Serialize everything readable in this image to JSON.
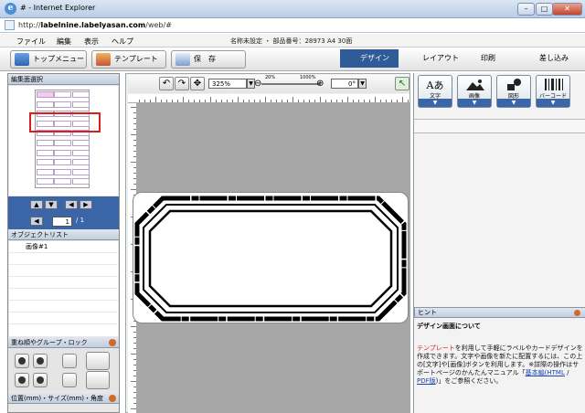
{
  "window": {
    "title": "# - Internet Explorer",
    "minimize": "–",
    "maximize": "□",
    "close": "✕",
    "icon": "ie-icon"
  },
  "address": {
    "prefix": "http://",
    "domain": "labelnine.labelyasan.com",
    "path": "/web/#"
  },
  "menu": {
    "items": [
      "ファイル",
      "編集",
      "表示",
      "ヘルプ"
    ],
    "docinfo": "名称未設定 ・ 部品番号：28973 A4 30面"
  },
  "toolbar": {
    "top_menu": "トップメニュー",
    "template": "テンプレート",
    "save": "保　存"
  },
  "modes": [
    "デザイン",
    "レイアウト",
    "印刷",
    "差し込み"
  ],
  "left": {
    "page_select_title": "編集面選択",
    "page_current": "1",
    "page_total": "/ 1",
    "object_list_title": "オブジェクトリスト",
    "objects": [
      "画像#1"
    ],
    "lock_title": "重ね順やグループ・ロック",
    "pos_title": "位置(mm)・サイズ(mm)・角度"
  },
  "edit": {
    "zoom": "325%",
    "zoom_min": "20%",
    "zoom_max": "1000%",
    "rotation": "0°"
  },
  "insert": {
    "text": "文字",
    "image": "画像",
    "shape": "図形",
    "barcode": "バーコード",
    "text_glyph": "Aあ"
  },
  "hint": {
    "title": "ヒント",
    "heading": "デザイン画面について",
    "body_link1": "テンプレート",
    "body1": "を利用して手軽にラベルやカードデザインを作成できます。文字や画像を新たに配置するには、この上の[文字]や[画像]ボタンを利用します。",
    "body2": "※詳際の操作はサポートページのかんたんマニュアル「",
    "link_html": "基本編(HTML",
    "sep": " / ",
    "link_pdf": "PDF版",
    "body3": ")」をご参照ください。"
  },
  "colors": {
    "accent": "#2f5b96",
    "highlight": "#d81e1e",
    "link": "#1a44b5"
  }
}
